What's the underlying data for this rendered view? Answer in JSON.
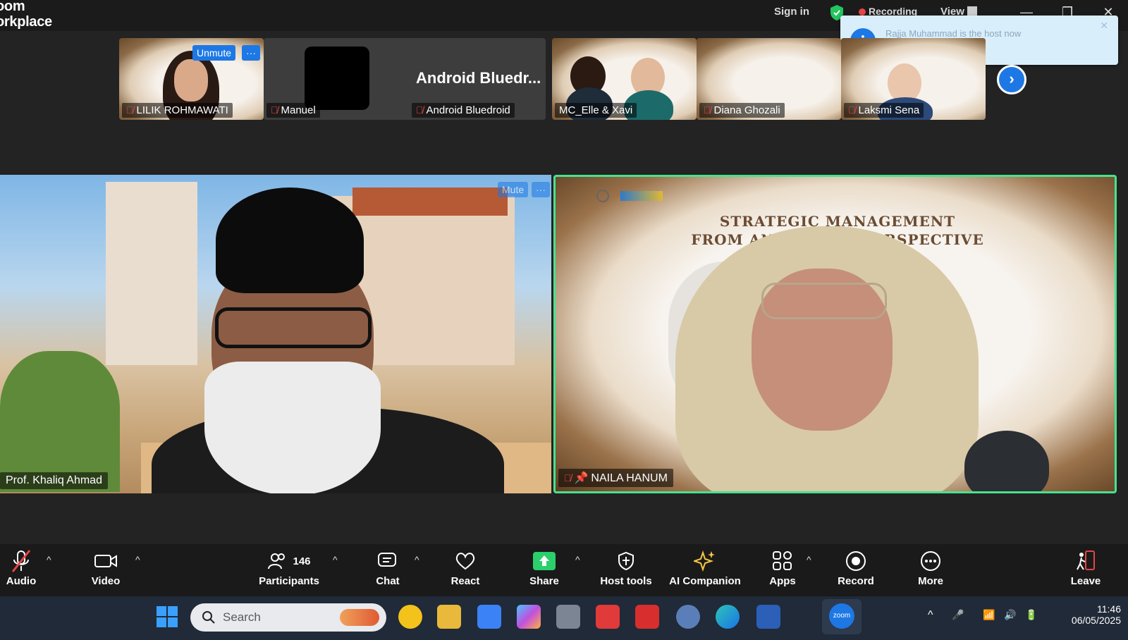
{
  "window": {
    "title_line1": "oom",
    "title_line2": "orkplace",
    "sign_in": "Sign in",
    "recording": "Recording",
    "view": "View"
  },
  "notification": {
    "message": "Rajja Muhammad is the host now"
  },
  "strip": {
    "unmute_label": "Unmute",
    "more_label": "···",
    "tiles": [
      {
        "name": "LILIK ROHMAWATI",
        "muted": true
      },
      {
        "name": "Manuel",
        "muted": true
      },
      {
        "name": "Android Bluedroid",
        "muted": true,
        "big_text": "Android  Bluedr..."
      },
      {
        "name": "MC_Elle & Xavi",
        "muted": false
      },
      {
        "name": "Diana Ghozali",
        "muted": true
      },
      {
        "name": "Laksmi Sena",
        "muted": true
      }
    ]
  },
  "main": {
    "left": {
      "name": "Prof. Khaliq Ahmad",
      "pill": "Mute"
    },
    "right": {
      "name": "NAILA HANUM",
      "slide_line1": "STRATEGIC MANAGEMENT",
      "slide_line2": "FROM AN ISLAMIC PERSPECTIVE"
    }
  },
  "toolbar": {
    "audio": "Audio",
    "video": "Video",
    "participants": "Participants",
    "participants_count": "146",
    "chat": "Chat",
    "react": "React",
    "share": "Share",
    "host_tools": "Host tools",
    "ai_companion": "AI Companion",
    "apps": "Apps",
    "record": "Record",
    "more": "More",
    "leave": "Leave"
  },
  "taskbar": {
    "search_placeholder": "Search",
    "time": "11:46",
    "date": "06/05/2025",
    "zoom_label": "zoom"
  },
  "colors": {
    "accent": "#1d78e5",
    "active_speaker": "#47e28f",
    "mute_red": "#e84545",
    "share_green": "#2bcf6b"
  }
}
